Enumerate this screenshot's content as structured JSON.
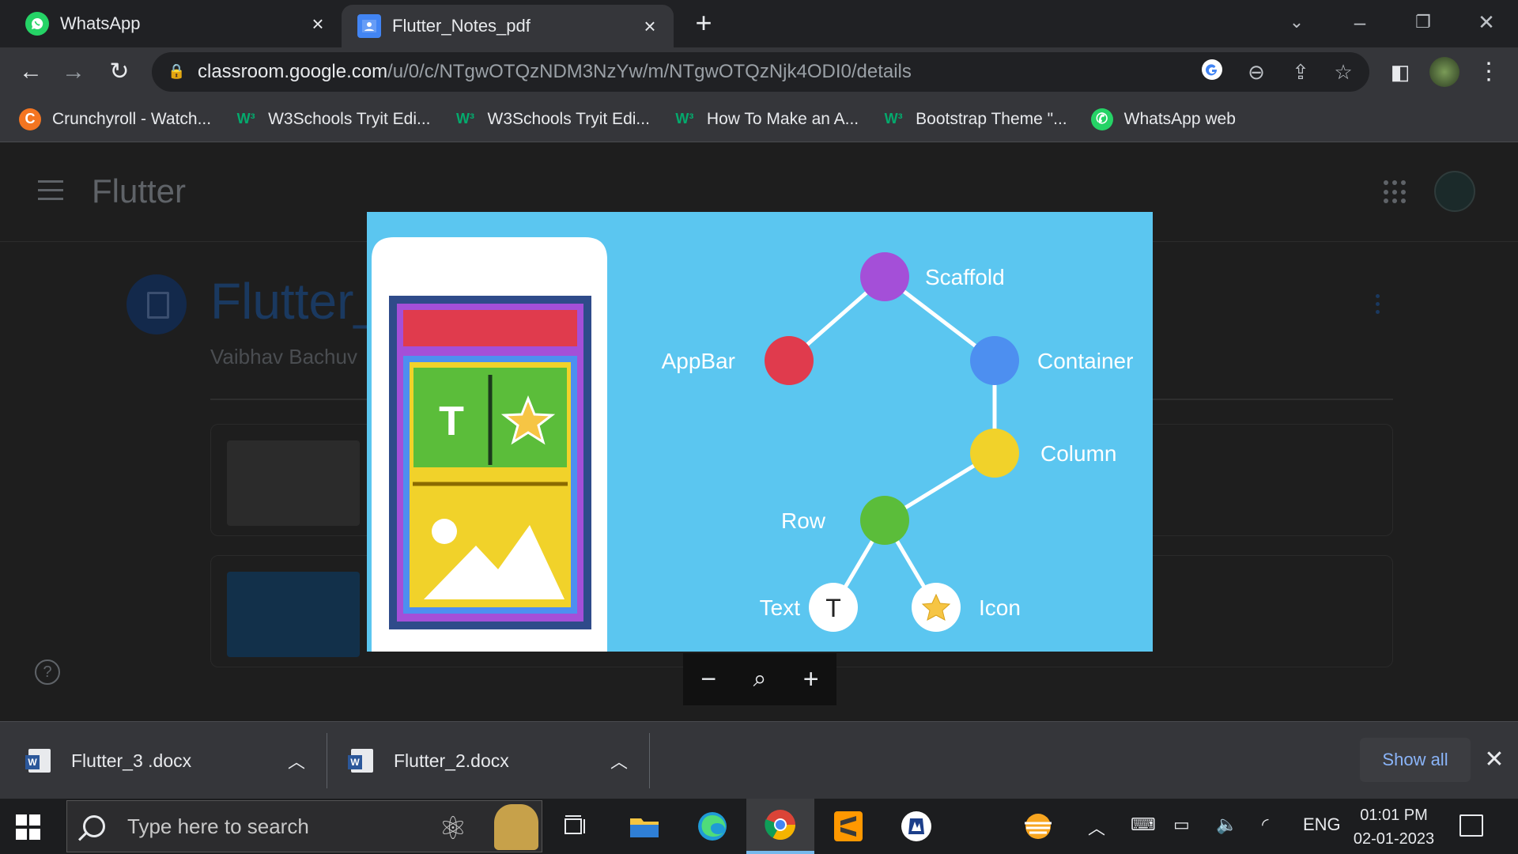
{
  "browser": {
    "tabs": [
      {
        "title": "WhatsApp",
        "active": false,
        "favicon": "whatsapp-icon"
      },
      {
        "title": "Flutter_Notes_pdf",
        "active": true,
        "favicon": "classroom-icon"
      }
    ],
    "url_host": "classroom.google.com",
    "url_path": "/u/0/c/NTgwOTQzNDM3NzYw/m/NTgwOTQzNjk4ODI0/details",
    "bookmarks": [
      {
        "label": "Crunchyroll - Watch...",
        "icon": "crunchyroll-icon"
      },
      {
        "label": "W3Schools Tryit Edi...",
        "icon": "w3schools-icon"
      },
      {
        "label": "W3Schools Tryit Edi...",
        "icon": "w3schools-icon"
      },
      {
        "label": "How To Make an A...",
        "icon": "w3schools-icon"
      },
      {
        "label": "Bootstrap Theme \"...",
        "icon": "w3schools-icon"
      },
      {
        "label": "WhatsApp web",
        "icon": "whatsapp-icon"
      }
    ]
  },
  "classroom": {
    "class_name": "Flutter",
    "material_title": "Flutter_",
    "author": "Vaibhav Bachuv"
  },
  "viewer_image": {
    "nodes": {
      "scaffold": "Scaffold",
      "appbar": "AppBar",
      "container": "Container",
      "column": "Column",
      "row": "Row",
      "text": "Text",
      "icon": "Icon",
      "text_glyph": "T"
    },
    "phone_text_glyph": "T",
    "colors": {
      "scaffold": "#a44fd8",
      "appbar": "#e03b4d",
      "container": "#4d8ff0",
      "column": "#f1d22a",
      "row": "#5bbd3a",
      "background": "#5bc6f0"
    }
  },
  "zoom": {
    "minus": "−",
    "plus": "+"
  },
  "downloads": {
    "items": [
      {
        "name": "Flutter_3 .docx"
      },
      {
        "name": "Flutter_2.docx"
      }
    ],
    "show_all": "Show all"
  },
  "taskbar": {
    "search_placeholder": "Type here to search",
    "language": "ENG",
    "time": "01:01 PM",
    "date": "02-01-2023"
  }
}
